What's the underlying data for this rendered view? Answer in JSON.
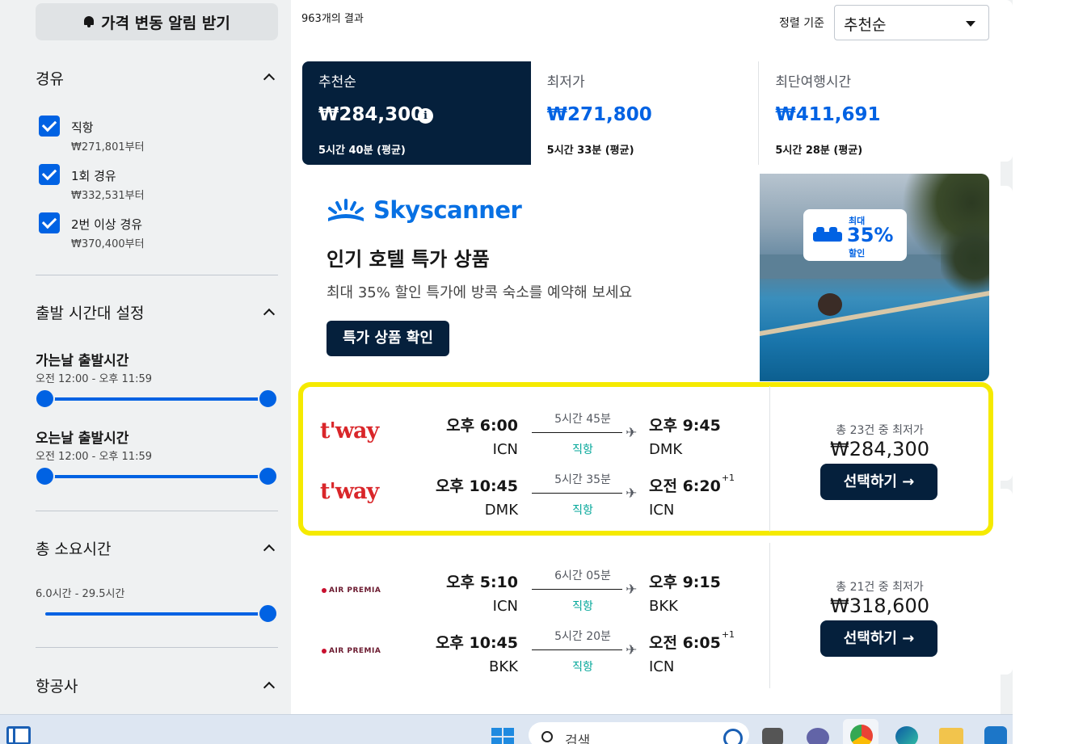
{
  "sidebar": {
    "alert_button": "가격 변동 알림 받기",
    "stops": {
      "title": "경유",
      "options": [
        {
          "label": "직항",
          "from": "₩271,801부터",
          "checked": true
        },
        {
          "label": "1회 경유",
          "from": "₩332,531부터",
          "checked": true
        },
        {
          "label": "2번 이상 경유",
          "from": "₩370,400부터",
          "checked": true
        }
      ]
    },
    "departure_times": {
      "title": "출발 시간대 설정",
      "outbound_title": "가는날 출발시간",
      "outbound_range": "오전 12:00 - 오후 11:59",
      "return_title": "오는날 출발시간",
      "return_range": "오전 12:00 - 오후 11:59"
    },
    "duration": {
      "title": "총 소요시간",
      "range": "6.0시간 - 29.5시간"
    },
    "airlines": {
      "title": "항공사"
    }
  },
  "header": {
    "results_count": "963개의 결과",
    "sort_label": "정렬 기준",
    "sort_value": "추천순"
  },
  "tabs": [
    {
      "label": "추천순",
      "price": "₩284,300",
      "sub": "5시간 40분 (평균)",
      "active": true
    },
    {
      "label": "최저가",
      "price": "₩271,800",
      "sub": "5시간 33분 (평균)",
      "active": false
    },
    {
      "label": "최단여행시간",
      "price": "₩411,691",
      "sub": "5시간 28분 (평균)",
      "active": false
    }
  ],
  "ad": {
    "brand": "Skyscanner",
    "title": "인기 호텔 특가 상품",
    "description": "최대 35% 할인 특가에 방콕 숙소를 예약해 보세요",
    "button": "특가 상품 확인",
    "badge_top": "최대",
    "badge_pct": "35%",
    "badge_bottom": "할인"
  },
  "flights": [
    {
      "highlighted": true,
      "legs": [
        {
          "airline_logo": "t'way",
          "dep_time": "오후 6:00",
          "dep_code": "ICN",
          "duration": "5시간 45분",
          "stops": "직항",
          "arr_time": "오후 9:45",
          "arr_plus": "",
          "arr_code": "DMK"
        },
        {
          "airline_logo": "t'way",
          "dep_time": "오후 10:45",
          "dep_code": "DMK",
          "duration": "5시간 35분",
          "stops": "직항",
          "arr_time": "오전 6:20",
          "arr_plus": "+1",
          "arr_code": "ICN"
        }
      ],
      "price_caption": "총 23건 중 최저가",
      "price": "₩284,300",
      "button": "선택하기 →"
    },
    {
      "highlighted": false,
      "legs": [
        {
          "airline_logo": "AIR PREMIA",
          "dep_time": "오후 5:10",
          "dep_code": "ICN",
          "duration": "6시간 05분",
          "stops": "직항",
          "arr_time": "오후 9:15",
          "arr_plus": "",
          "arr_code": "BKK"
        },
        {
          "airline_logo": "AIR PREMIA",
          "dep_time": "오후 10:45",
          "dep_code": "BKK",
          "duration": "5시간 20분",
          "stops": "직항",
          "arr_time": "오전 6:05",
          "arr_plus": "+1",
          "arr_code": "ICN"
        }
      ],
      "price_caption": "총 21건 중 최저가",
      "price": "₩318,600",
      "button": "선택하기 →"
    }
  ],
  "taskbar": {
    "search_placeholder": "검색"
  },
  "colors": {
    "accent_blue": "#0062e3",
    "navy": "#05203c",
    "highlight_yellow": "#f5ea00",
    "stops_teal": "#00a698"
  }
}
